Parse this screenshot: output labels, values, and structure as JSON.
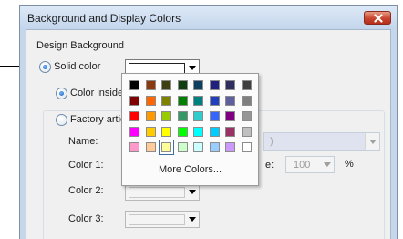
{
  "dialog": {
    "title": "Background and Display Colors",
    "close_icon": "close-icon"
  },
  "design_background": {
    "label": "Design Background",
    "solid_color_label": "Solid color",
    "color_inside_label": "Color inside h",
    "factory_label": "Factory articl",
    "name_label": "Name:",
    "color1_label": "Color 1:",
    "color2_label": "Color 2:",
    "color3_label": "Color 3:",
    "name_value_fragment": ")",
    "percent_label_fragment": "e:",
    "percent_value": "100",
    "percent_unit": "%"
  },
  "color_popup": {
    "more_colors_label": "More Colors...",
    "selected_index": 34,
    "colors": [
      "#000000",
      "#8b3a0f",
      "#3f3f11",
      "#0f3f0f",
      "#0f3f5f",
      "#1f1f7f",
      "#2f2f5f",
      "#3f3f3f",
      "#7f0000",
      "#ff6600",
      "#7f7f00",
      "#007f00",
      "#007f7f",
      "#1f3fbf",
      "#5f5f9f",
      "#7f7f7f",
      "#ff0000",
      "#ff9900",
      "#99cc00",
      "#339966",
      "#33cccc",
      "#3366ff",
      "#800080",
      "#969696",
      "#ff00ff",
      "#ffcc00",
      "#ffff00",
      "#00ff00",
      "#00ffff",
      "#00ccff",
      "#993366",
      "#c0c0c0",
      "#ff99cc",
      "#ffcc99",
      "#ffff99",
      "#ccffcc",
      "#ccffff",
      "#99ccff",
      "#cc99ff",
      "#ffffff"
    ]
  }
}
